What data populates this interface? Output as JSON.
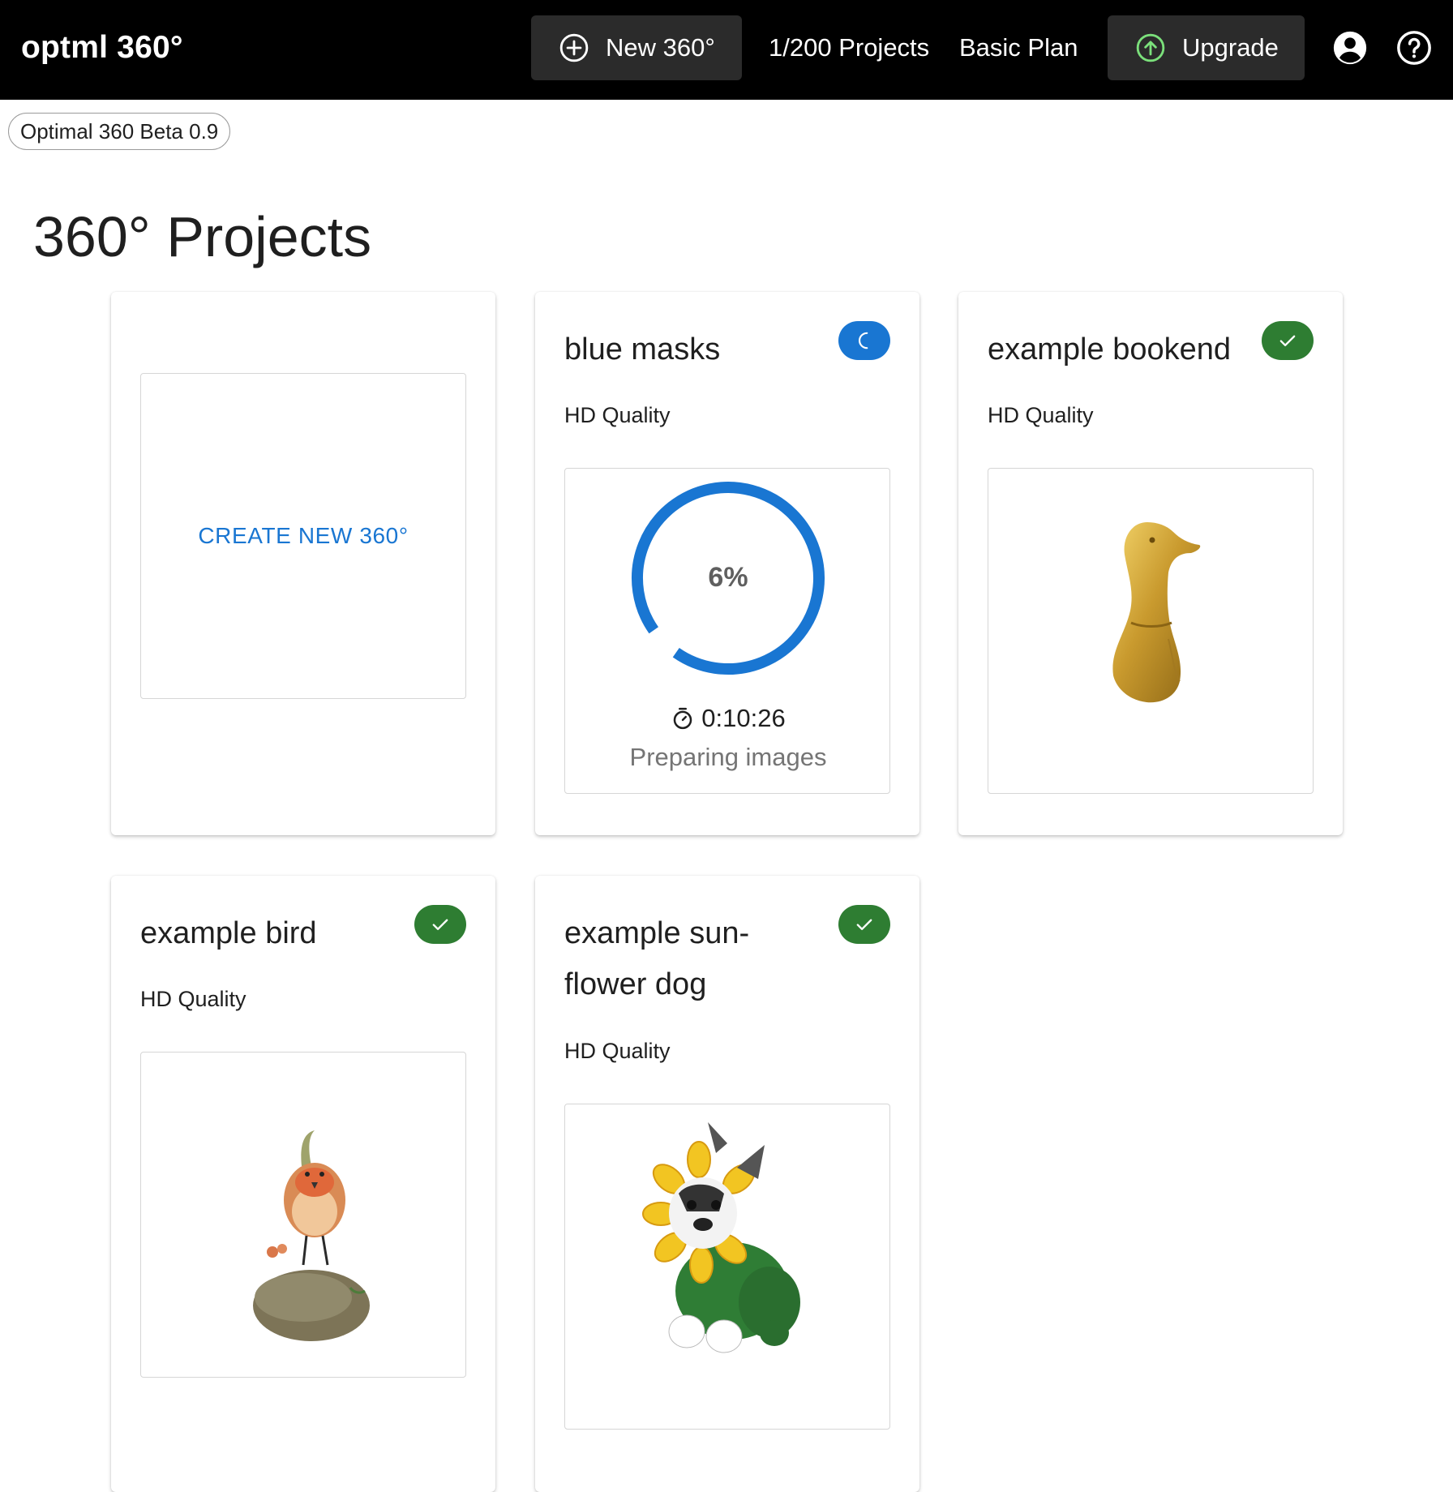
{
  "header": {
    "brand": "optml 360°",
    "new_button_label": "New 360°",
    "projects_count": "1/200 Projects",
    "plan": "Basic Plan",
    "upgrade_label": "Upgrade",
    "icons": {
      "new": "plus-circle-icon",
      "upgrade": "arrow-up-circle-icon",
      "account": "account-circle-icon",
      "help": "help-circle-icon"
    }
  },
  "version": "Optimal 360 Beta 0.9",
  "page_title": "360° Projects",
  "create_card": {
    "label": "CREATE NEW 360°"
  },
  "projects": [
    {
      "title": "blue masks",
      "quality": "HD Quality",
      "status": "processing",
      "status_icon": "spinner-icon",
      "progress": {
        "percent_label": "6%",
        "time": "0:10:26",
        "stage": "Preparing images"
      }
    },
    {
      "title": "example bookend",
      "quality": "HD Quality",
      "status": "done",
      "status_icon": "check-icon",
      "thumbnail": "gold-duck-bookend"
    },
    {
      "title": "example bird",
      "quality": "HD Quality",
      "status": "done",
      "status_icon": "check-icon",
      "thumbnail": "bird-on-rock-figurine"
    },
    {
      "title": "example sun-flower dog",
      "quality": "HD Quality",
      "status": "done",
      "status_icon": "check-icon",
      "thumbnail": "sunflower-dog-figurine"
    }
  ],
  "colors": {
    "header_bg": "#000000",
    "button_bg": "#2b2b2b",
    "accent_blue": "#1976d2",
    "success_green": "#2e7d32",
    "upgrade_icon_green": "#7be07b"
  }
}
